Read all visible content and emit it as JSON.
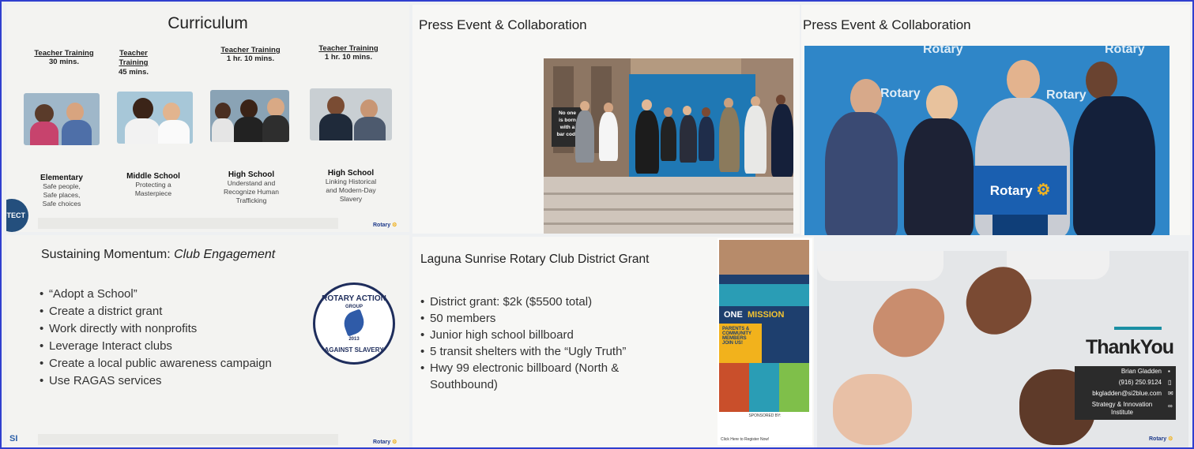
{
  "curriculum": {
    "title": "Curriculum",
    "columns": [
      {
        "heading": "Teacher Training",
        "duration": "30 mins."
      },
      {
        "heading": "Teacher Training",
        "duration": "45 mins."
      },
      {
        "heading": "Teacher Training",
        "duration": "1 hr. 10 mins."
      },
      {
        "heading": "Teacher Training",
        "duration": "1 hr. 10 mins."
      }
    ],
    "levels": [
      {
        "name": "Elementary",
        "desc": [
          "Safe people,",
          "Safe places,",
          "Safe choices"
        ]
      },
      {
        "name": "Middle School",
        "desc": [
          "Protecting a",
          "Masterpiece"
        ]
      },
      {
        "name": "High School",
        "desc": [
          "Understand and",
          "Recognize Human",
          "Trafficking"
        ]
      },
      {
        "name": "High School",
        "desc": [
          "Linking Historical",
          "and Modern-Day",
          "Slavery"
        ]
      }
    ],
    "corner_text": "OTECT",
    "footer_brand": "Rotary"
  },
  "press_event_1": {
    "title": "Press Event & Collaboration",
    "sign_text": [
      "No one",
      "is born",
      "with a",
      "bar code"
    ]
  },
  "press_event_2": {
    "title": "Press Event & Collaboration",
    "banner_words": [
      "Rotary",
      "Rotary",
      "Rotary",
      "Rotary"
    ],
    "podium_text": "Rotary"
  },
  "sustaining": {
    "title_plain": "Sustaining Momentum:",
    "title_italic": "Club Engagement",
    "bullets": [
      "“Adopt a School”",
      "Create a district grant",
      "Work directly with nonprofits",
      "Leverage Interact clubs",
      "Create a local public awareness campaign",
      "Use RAGAS services"
    ],
    "badge_top": "ROTARY ACTION",
    "badge_group": "GROUP",
    "badge_year": "2013",
    "badge_bottom": "AGAINST SLAVERY",
    "corner_logo": "SI",
    "footer_brand": "Rotary"
  },
  "grant": {
    "title": "Laguna Sunrise Rotary Club District Grant",
    "bullets": [
      "District grant: $2k ($5500 total)",
      "50 members",
      "Junior high school billboard",
      "5 transit shelters with the “Ugly Truth”",
      "Hwy 99 electronic billboard (North & Southbound)"
    ],
    "flyer_one": "ONE",
    "flyer_mission": "MISSION",
    "flyer_parents": "PARENTS &\nCOMMUNITY\nMEMBERS\nJOIN US!",
    "flyer_sponsored": "SPONSORED BY:",
    "flyer_register": "Click Here to Register Now!"
  },
  "thank_you": {
    "title": "ThankYou",
    "name": "Brian Gladden",
    "phone": "(916) 250.9124",
    "email": "bkgladden@si2blue.com",
    "org": "Strategy & Innovation Institute",
    "footer_brand": "Rotary"
  }
}
